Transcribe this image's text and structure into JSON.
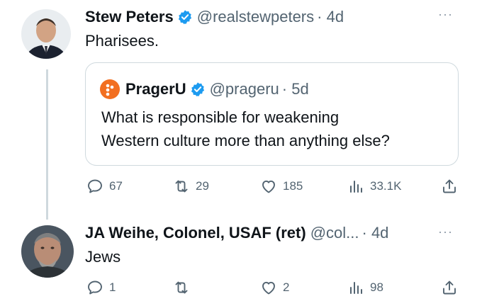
{
  "tweet1": {
    "author_name": "Stew Peters",
    "handle": "@realstewpeters",
    "time": "· 4d",
    "text": "Pharisees.",
    "more_label": "···"
  },
  "quote": {
    "author_name": "PragerU",
    "handle": "@prageru",
    "time": "· 5d",
    "line1": "What is responsible for weakening",
    "line2": "Western culture more than anything else?"
  },
  "tweet1_actions": {
    "reply_count": "67",
    "retweet_count": "29",
    "like_count": "185",
    "views_count": "33.1K"
  },
  "tweet2": {
    "author_name": "JA Weihe, Colonel, USAF (ret)",
    "handle": "@col...",
    "time": "· 4d",
    "text": "Jews",
    "more_label": "···"
  },
  "tweet2_actions": {
    "reply_count": "1",
    "retweet_count": "",
    "like_count": "2",
    "views_count": "98"
  },
  "colors": {
    "verified": "#1d9bf0",
    "secondary_text": "#536471",
    "border": "#cfd9de",
    "prageru_brand": "#f26f21"
  }
}
